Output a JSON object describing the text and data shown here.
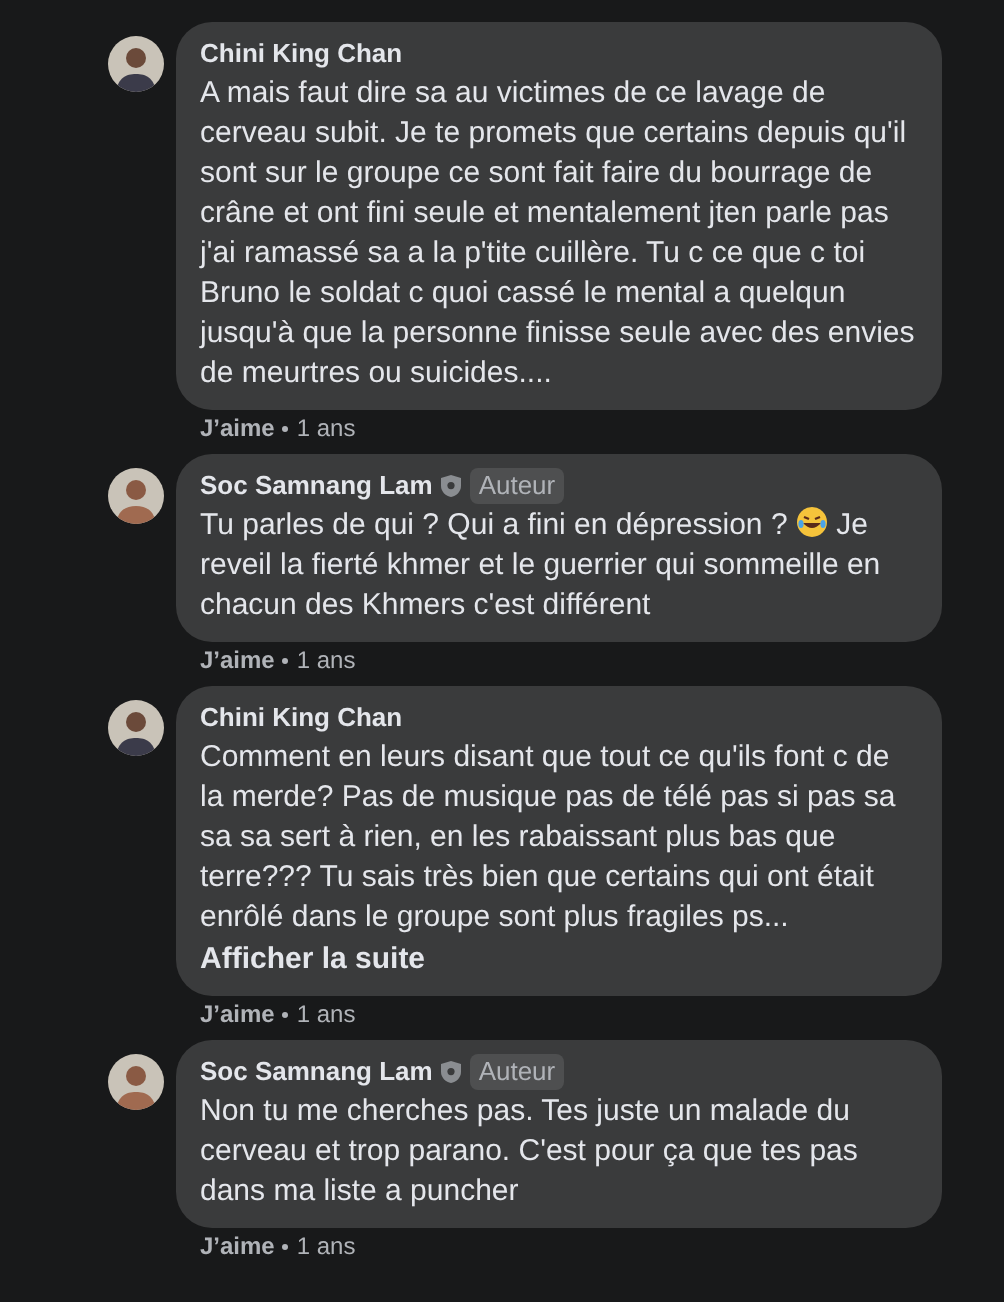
{
  "comments": [
    {
      "author": "Chini King Chan",
      "body": [
        {
          "kind": "text",
          "text": "A mais faut dire sa au victimes de ce lavage de cerveau subit. Je te promets que certains depuis qu'il sont sur le groupe ce sont fait faire du bourrage de crâne et ont fini seule et mentalement jten parle pas j'ai ramassé sa a la p'tite cuillère. Tu c ce que c toi Bruno le soldat c quoi cassé le mental a quelqun jusqu'à que la personne finisse seule avec des envies de meurtres ou suicides...."
        }
      ],
      "like": "J’aime",
      "time": "1 ans"
    },
    {
      "author": "Soc Samnang Lam",
      "author_badge": "Auteur",
      "body": [
        {
          "kind": "text",
          "text": "Tu parles de qui ? Qui a fini en dépression ?"
        },
        {
          "kind": "emoji"
        },
        {
          "kind": "text",
          "text": "Je"
        },
        {
          "kind": "text",
          "text": "reveil la fierté khmer et le guerrier qui sommeille en chacun des Khmers c'est différent"
        }
      ],
      "like": "J’aime",
      "time": "1 ans"
    },
    {
      "author": "Chini King Chan",
      "body": [
        {
          "kind": "text",
          "text": "Comment en leurs disant que tout ce qu'ils font c de la merde? Pas de musique pas de télé pas si pas sa sa sa sert à rien, en les rabaissant plus bas que terre??? Tu sais très bien que certains qui ont était enrôlé dans le groupe sont plus fragiles ps..."
        }
      ],
      "see_more": "Afficher la suite",
      "like": "J’aime",
      "time": "1 ans"
    },
    {
      "author": "Soc Samnang Lam",
      "author_badge": "Auteur",
      "body": [
        {
          "kind": "text",
          "text": "Non tu me cherches pas. Tes juste un malade du cerveau et trop parano. C'est pour ça que tes pas dans ma liste a puncher"
        }
      ],
      "like": "J’aime",
      "time": "1 ans"
    }
  ]
}
